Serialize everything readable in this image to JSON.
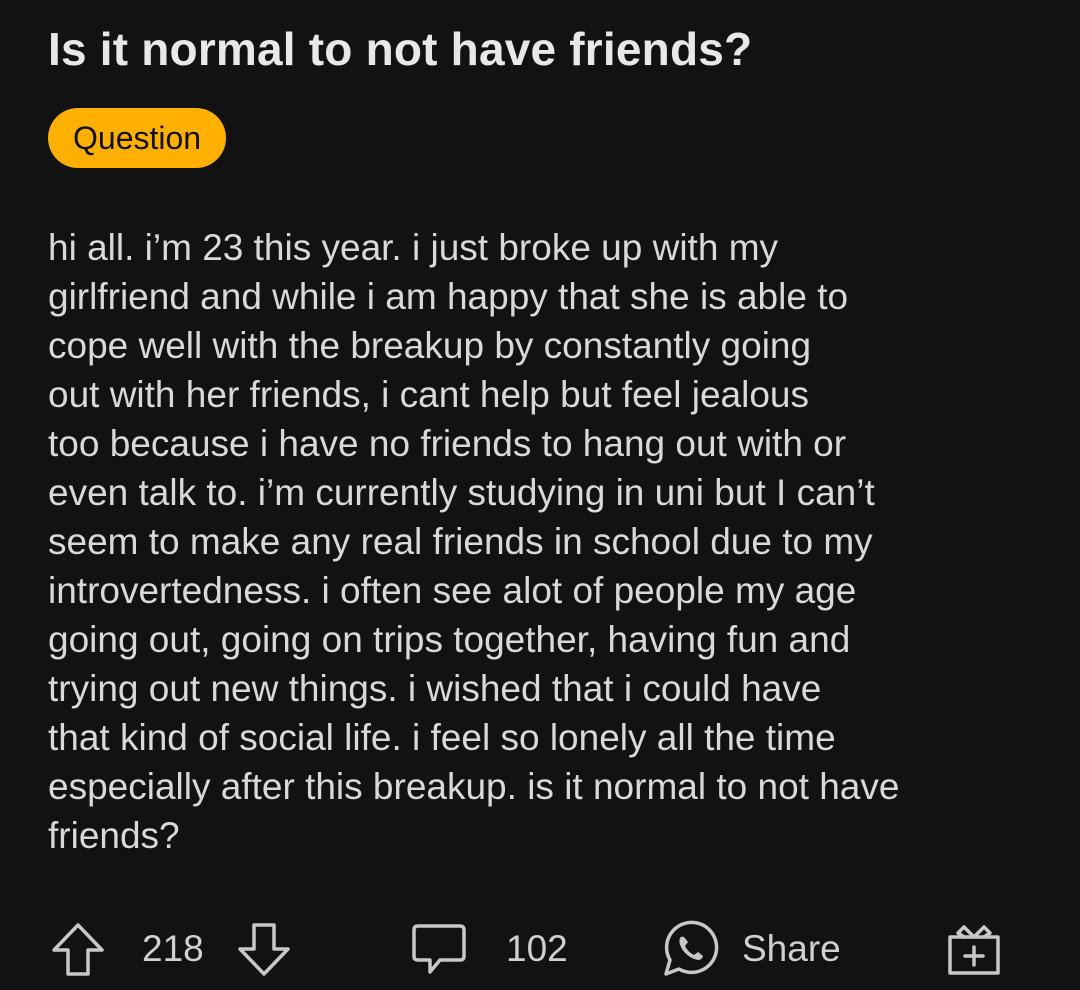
{
  "post": {
    "title": "Is it normal to not have friends?",
    "flair": "Question",
    "body_lines": [
      "hi all. i’m 23 this year. i just broke up with my",
      "girlfriend and while i am happy that she is able to",
      "cope well with the breakup by constantly going",
      "out with her friends, i cant help but feel jealous",
      "too because i have no friends to hang out with or",
      "even talk to. i’m currently studying in uni but I can’t",
      "seem to make any real friends in school due to my",
      "introvertedness. i often see alot of people my age",
      "going out, going on trips together, having fun and",
      "trying out new things. i wished that i could have",
      "that kind of social life. i feel so lonely all the time",
      "especially after this breakup. is it normal to not have",
      "friends?"
    ]
  },
  "actions": {
    "votes": "218",
    "comments": "102",
    "share_label": "Share"
  },
  "icons": {
    "upvote": "upvote-arrow-icon",
    "downvote": "downvote-arrow-icon",
    "comments": "comment-bubble-icon",
    "share": "whatsapp-share-icon",
    "award": "gift-award-icon"
  },
  "colors": {
    "background": "#121212",
    "flair": "#ffb000",
    "text": "#d9d9d9"
  }
}
